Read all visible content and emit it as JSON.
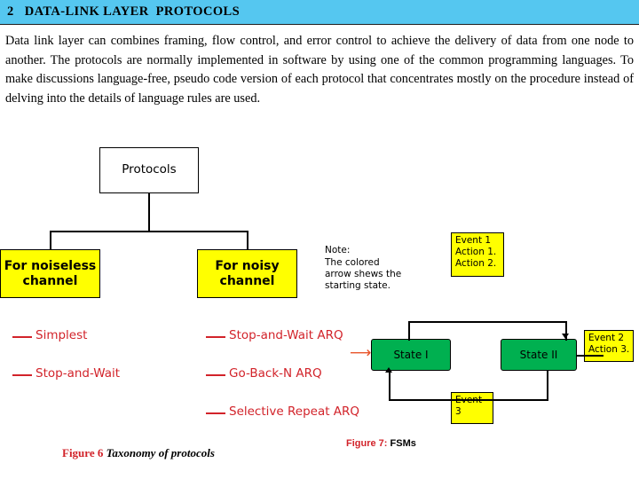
{
  "header": {
    "title": "2   DATA-LINK LAYER  PROTOCOLS",
    "bar_color": "#55c7f0"
  },
  "body": {
    "paragraph": "Data link layer can combines framing, flow control, and error control to achieve the delivery of data from one node to another. The protocols are normally implemented in software by using one of the common programming languages. To make discussions language-free,  pseudo code version of each protocol that concentrates mostly on the procedure instead of delving into the details of language rules are used."
  },
  "figure6": {
    "root_label": "Protocols",
    "branch_left": "For noiseless\nchannel",
    "branch_right": "For noisy\nchannel",
    "left_leaves": [
      "Simplest",
      "Stop-and-Wait"
    ],
    "right_leaves": [
      "Stop-and-Wait ARQ",
      "Go-Back-N ARQ",
      "Selective Repeat ARQ"
    ],
    "caption_bold": "Figure 6 ",
    "caption_italic": "Taxonomy of protocols"
  },
  "figure7": {
    "note_title": "Note:",
    "note_body": "The colored arrow shews the starting state.",
    "event1": "Event 1\nAction 1.\nAction 2.",
    "event2": "Event 2\nAction 3.",
    "event3": "Event 3",
    "state1": "State I",
    "state2": "State II",
    "caption_bold": "Figure 7:",
    "caption_rest": " FSMs"
  },
  "colors": {
    "accent_red": "#d2232a",
    "highlight_yellow": "#ffff00",
    "state_green": "#00b050",
    "header_blue": "#55c7f0"
  }
}
